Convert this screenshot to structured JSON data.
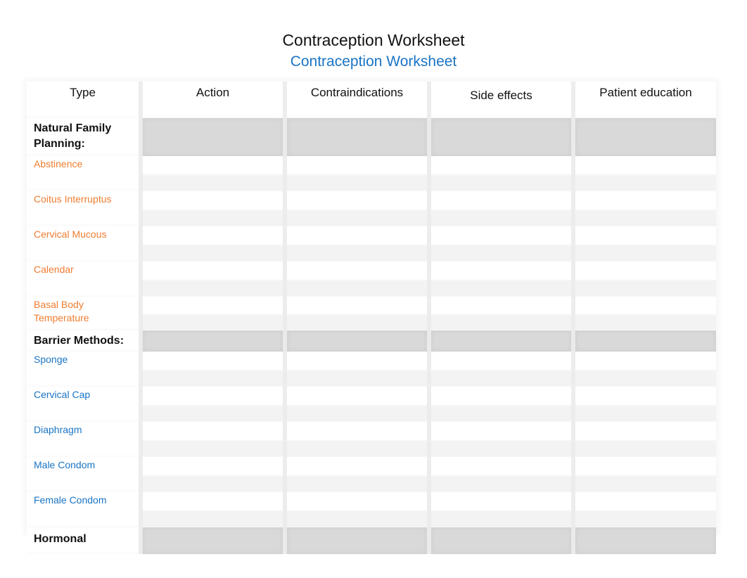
{
  "document": {
    "title": "Contraception Worksheet",
    "subtitle": "Contraception Worksheet",
    "colors": {
      "subtitle": "#1a74c4",
      "nfp_items": "#ee7d31",
      "barrier_items": "#1a74c4",
      "section_band": "#d9d9d9"
    }
  },
  "table": {
    "headers": [
      "Type",
      "Action",
      "Contraindications",
      "Side effects",
      "Patient education"
    ],
    "sections": [
      {
        "label": "Natural Family Planning:",
        "items": [
          "Abstinence",
          "Coitus Interruptus",
          "Cervical Mucous",
          "Calendar",
          "Basal Body Temperature"
        ]
      },
      {
        "label": "Barrier Methods:",
        "items": [
          "Sponge",
          "Cervical Cap",
          "Diaphragm",
          "Male Condom",
          "Female Condom"
        ]
      },
      {
        "label": "Hormonal",
        "items": []
      }
    ]
  }
}
